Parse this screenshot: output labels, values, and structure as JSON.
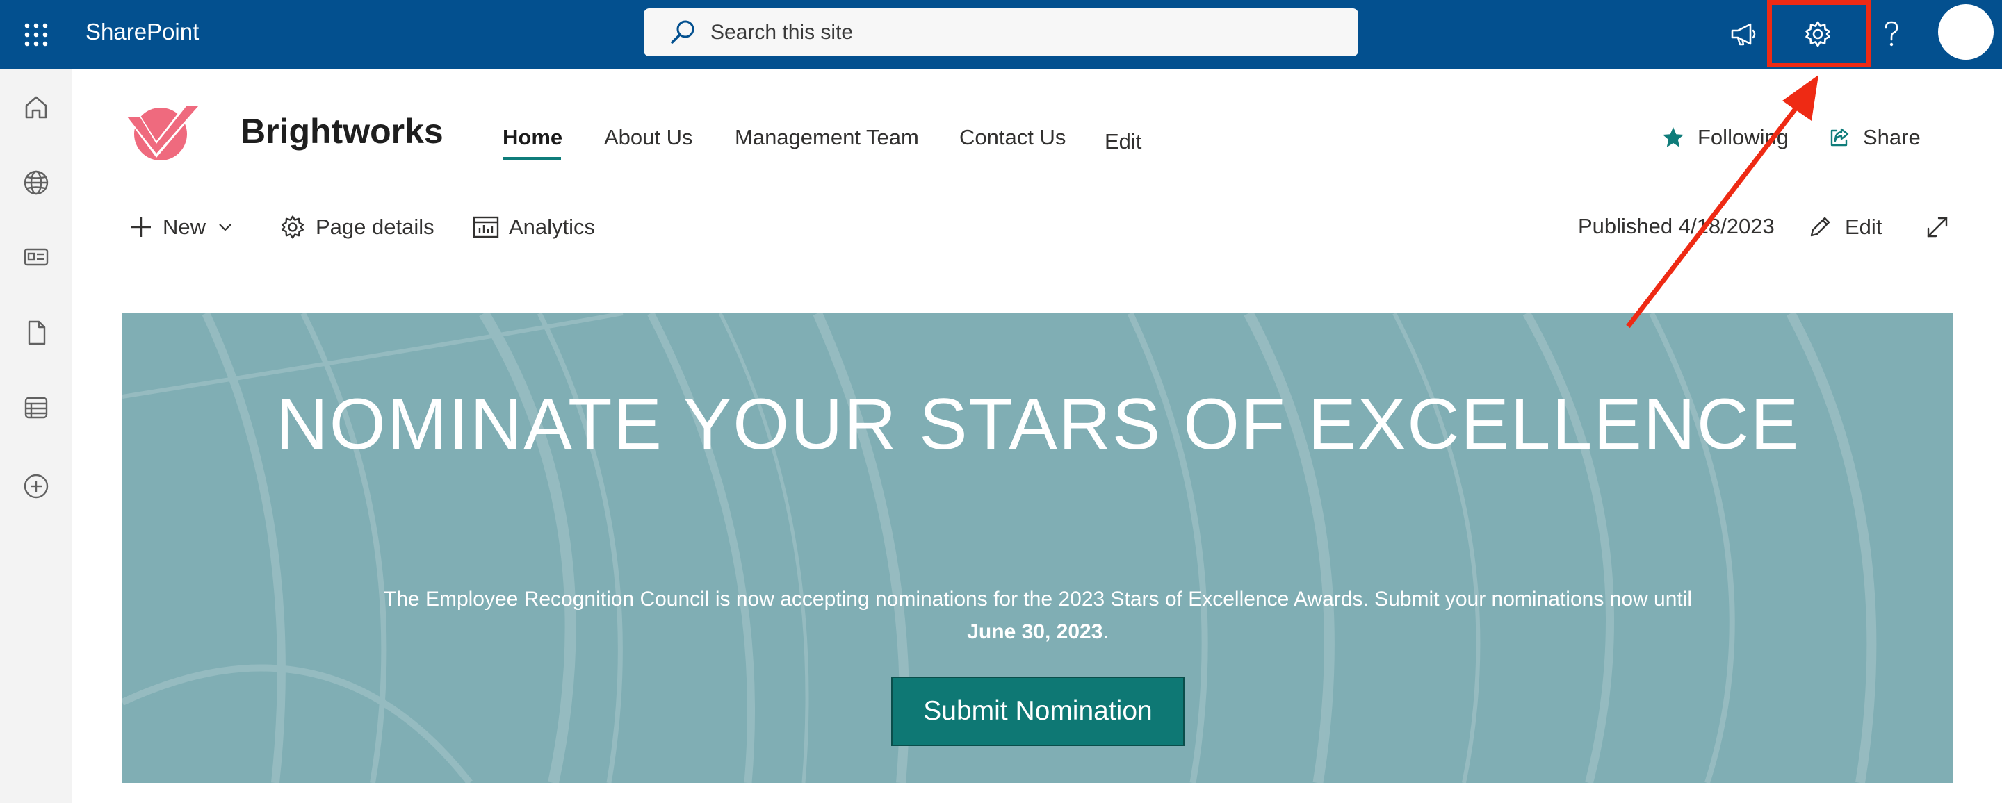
{
  "suitebar": {
    "app_name": "SharePoint",
    "search_placeholder": "Search this site",
    "background": "#03508f"
  },
  "site": {
    "title": "Brightworks",
    "nav": [
      "Home",
      "About Us",
      "Management Team",
      "Contact Us",
      "Edit"
    ],
    "following_label": "Following",
    "share_label": "Share"
  },
  "commandbar": {
    "new_label": "New",
    "page_details_label": "Page details",
    "analytics_label": "Analytics",
    "published": "Published 4/18/2023",
    "edit_label": "Edit"
  },
  "hero": {
    "title": "NOMINATE YOUR STARS OF EXCELLENCE",
    "body": "The Employee Recognition Council is now accepting nominations for the 2023 Stars of Excellence Awards. Submit your nominations now until",
    "deadline": "June 30, 2023",
    "deadline_suffix": ".",
    "button_label": "Submit Nomination",
    "background": "#80aeb4",
    "button_color": "#0e7874"
  },
  "annotation": {
    "color": "#ee2a14",
    "target": "settings-icon"
  },
  "icons": [
    "app-launcher-icon",
    "search-icon",
    "megaphone-icon",
    "gear-icon",
    "help-icon",
    "home-icon",
    "globe-icon",
    "news-icon",
    "document-icon",
    "list-icon",
    "add-circle-icon",
    "star-icon",
    "share-icon",
    "plus-icon",
    "chevron-down-icon",
    "page-details-icon",
    "analytics-icon",
    "pencil-icon",
    "expand-icon"
  ]
}
